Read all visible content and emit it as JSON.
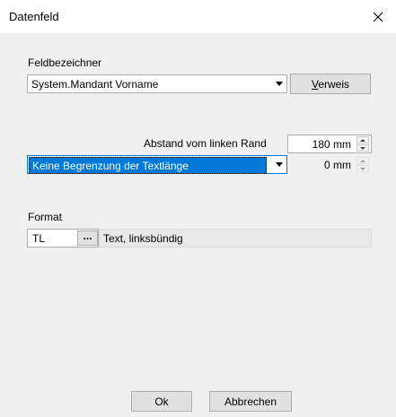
{
  "window": {
    "title": "Datenfeld",
    "close_symbol": "✕"
  },
  "feldbezeichner": {
    "label": "Feldbezeichner",
    "combo_value": "System.Mandant Vorname",
    "verweis_accel": "V",
    "verweis_rest": "erweis"
  },
  "abstand": {
    "label": "Abstand vom linken Rand",
    "value": "180 mm"
  },
  "textlaenge": {
    "combo_value": "Keine Begrenzung der Textlänge",
    "value": "0 mm"
  },
  "format": {
    "label": "Format",
    "code": "TL",
    "ellipsis": "...",
    "description": "Text, linksbündig"
  },
  "buttons": {
    "ok": "Ok",
    "cancel": "Abbrechen"
  },
  "colors": {
    "selection": "#0078d7",
    "dialog_bg": "#f0f0f0"
  }
}
